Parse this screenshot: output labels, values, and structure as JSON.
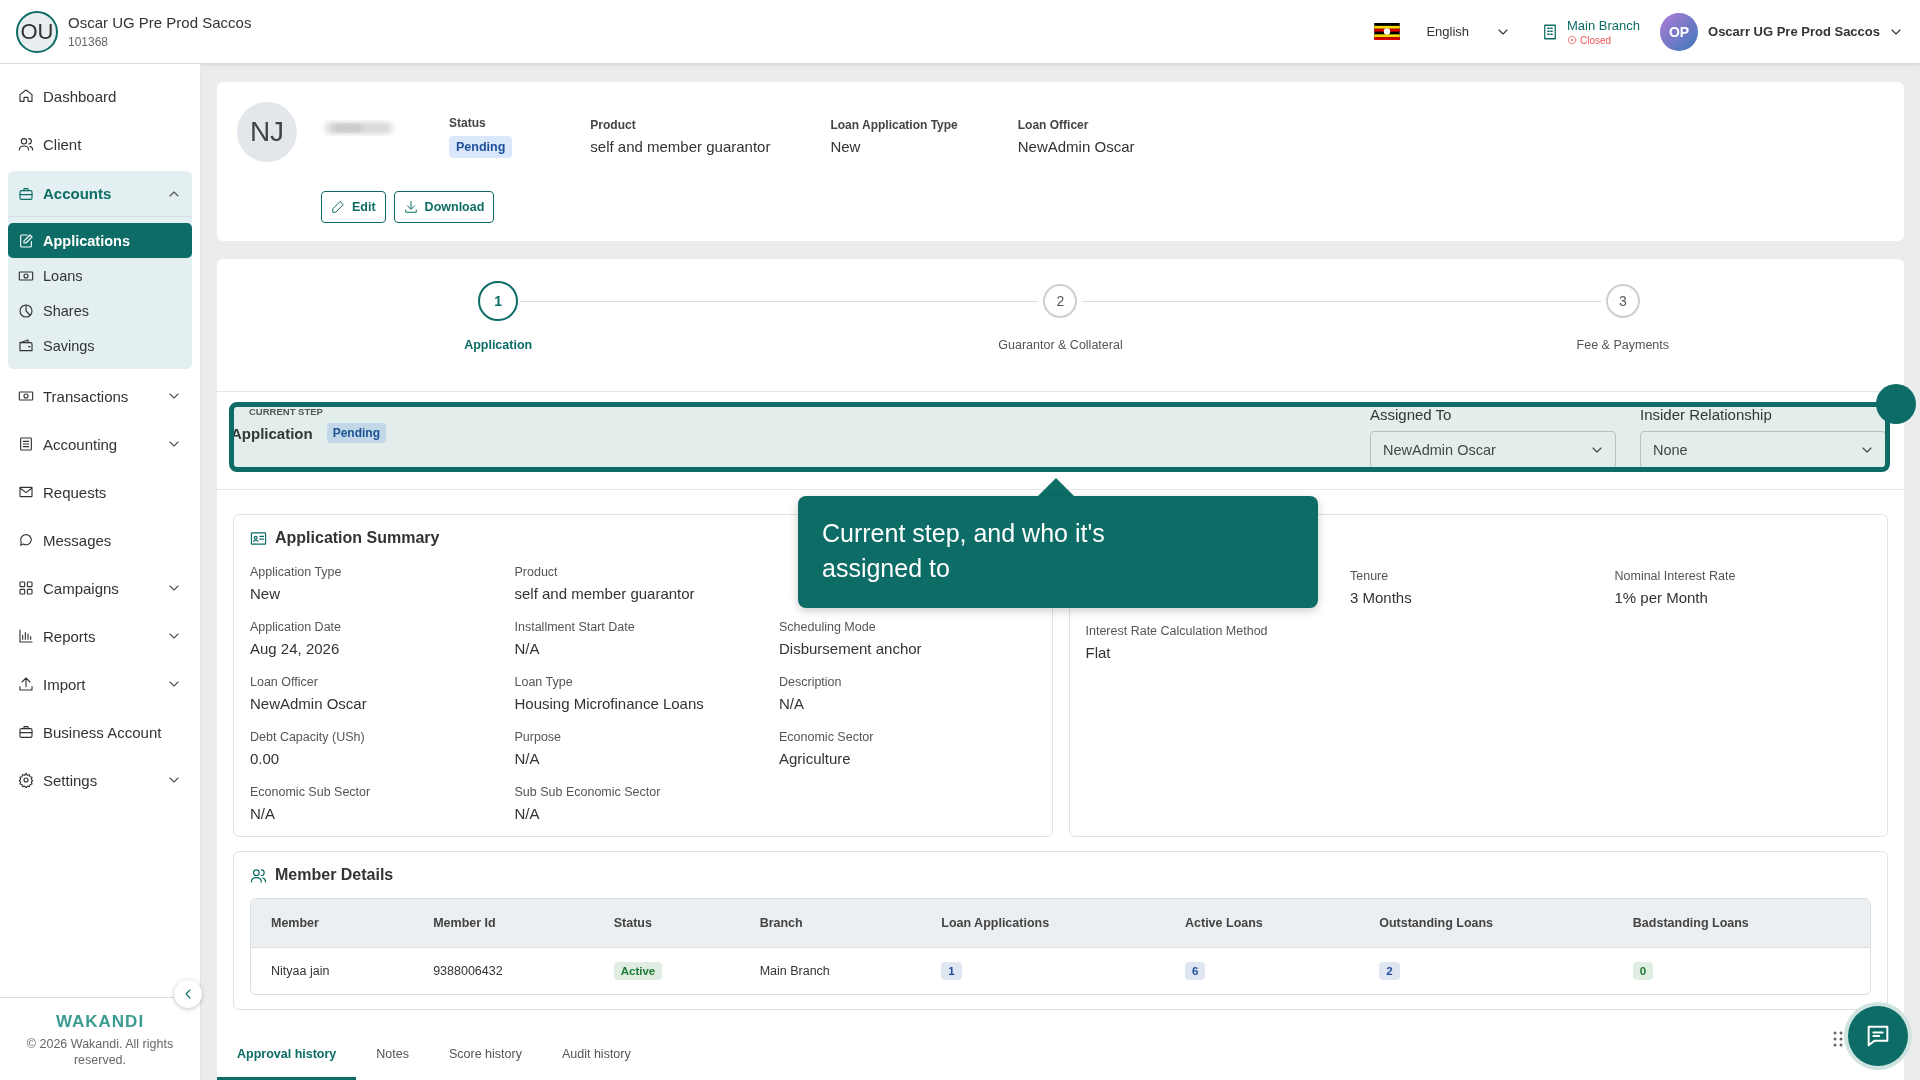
{
  "header": {
    "org_initials": "OU",
    "org_name": "Oscar UG Pre Prod Saccos",
    "org_code": "101368",
    "language": "English",
    "branch": "Main Branch",
    "branch_status": "Closed",
    "user_initials": "OP",
    "user_name": "Oscarr UG Pre Prod Saccos"
  },
  "sidebar": {
    "items": [
      {
        "label": "Dashboard"
      },
      {
        "label": "Client"
      },
      {
        "label": "Accounts",
        "expanded": true,
        "children": [
          {
            "label": "Applications",
            "selected": true
          },
          {
            "label": "Loans",
            "selected": false
          },
          {
            "label": "Shares",
            "selected": false
          },
          {
            "label": "Savings",
            "selected": false
          }
        ]
      },
      {
        "label": "Transactions",
        "expanded": false
      },
      {
        "label": "Accounting",
        "expanded": false
      },
      {
        "label": "Requests"
      },
      {
        "label": "Messages"
      },
      {
        "label": "Campaigns",
        "expanded": false
      },
      {
        "label": "Reports",
        "expanded": false
      },
      {
        "label": "Import",
        "expanded": false
      },
      {
        "label": "Business Account"
      },
      {
        "label": "Settings",
        "expanded": false
      }
    ],
    "brand": "WAKANDI",
    "copyright": "© 2026 Wakandi. All rights reserved."
  },
  "profile": {
    "initials": "NJ",
    "fields": [
      {
        "label": "Status",
        "value": "Pending",
        "kind": "badge"
      },
      {
        "label": "Product",
        "value": "self and member guarantor",
        "kind": "text"
      },
      {
        "label": "Loan Application Type",
        "value": "New",
        "kind": "text"
      },
      {
        "label": "Loan Officer",
        "value": "NewAdmin Oscar",
        "kind": "text"
      }
    ],
    "buttons": [
      "Edit",
      "Download"
    ]
  },
  "stepper": {
    "steps": [
      {
        "number": "1",
        "label": "Application",
        "selected": true
      },
      {
        "number": "2",
        "label": "Guarantor & Collateral",
        "selected": false
      },
      {
        "number": "3",
        "label": "Fee & Payments",
        "selected": false
      }
    ]
  },
  "current_step": {
    "caption": "CURRENT STEP",
    "name": "Application",
    "status": "Pending",
    "assigned_to": {
      "label": "Assigned To",
      "value": "NewAdmin Oscar"
    },
    "insider_relationship": {
      "label": "Insider Relationship",
      "value": "None"
    }
  },
  "tour_tooltip": {
    "text": "Current step, and who it's assigned to"
  },
  "application_summary": {
    "title": "Application Summary",
    "left_rows": [
      [
        {
          "label": "Application Type",
          "value": "New"
        },
        {
          "label": "Product",
          "value": "self and member guarantor"
        }
      ],
      [
        {
          "label": "Application Date",
          "value": "Aug 24, 2026"
        },
        {
          "label": "Installment Start Date",
          "value": "N/A"
        },
        {
          "label": "Scheduling Mode",
          "value": "Disbursement anchor"
        }
      ],
      [
        {
          "label": "Loan Officer",
          "value": "NewAdmin Oscar"
        },
        {
          "label": "Loan Type",
          "value": "Housing Microfinance Loans"
        },
        {
          "label": "Description",
          "value": "N/A"
        }
      ],
      [
        {
          "label": "Debt Capacity (USh)",
          "value": "0.00"
        },
        {
          "label": "Purpose",
          "value": "N/A"
        },
        {
          "label": "Economic Sector",
          "value": "Agriculture"
        }
      ],
      [
        {
          "label": "Economic Sub Sector",
          "value": "N/A"
        },
        {
          "label": "Sub Sub Economic Sector",
          "value": "N/A"
        }
      ]
    ],
    "right_rows": [
      [
        {
          "label": "Tenure",
          "value": "3 Months"
        },
        {
          "label": "Nominal Interest Rate",
          "value": "1% per Month"
        }
      ],
      [
        {
          "label": "Interest Rate Calculation Method",
          "value": "Flat"
        }
      ]
    ]
  },
  "member_details": {
    "title": "Member Details",
    "columns": [
      "Member",
      "Member Id",
      "Status",
      "Branch",
      "Loan Applications",
      "Active Loans",
      "Outstanding Loans",
      "Badstanding Loans"
    ],
    "rows": [
      [
        {
          "kind": "text",
          "value": "Nityaa jain"
        },
        {
          "kind": "text",
          "value": "9388006432"
        },
        {
          "kind": "badge",
          "value": "Active",
          "color": "#1e7b34"
        },
        {
          "kind": "text",
          "value": "Main Branch"
        },
        {
          "kind": "badge",
          "value": "1",
          "color": "#1e4f9c"
        },
        {
          "kind": "badge",
          "value": "6",
          "color": "#1e4f9c"
        },
        {
          "kind": "badge",
          "value": "2",
          "color": "#1e4f9c"
        },
        {
          "kind": "badge",
          "value": "0",
          "color": "#1e7b34"
        }
      ]
    ]
  },
  "tabs": [
    {
      "label": "Approval history",
      "selected": true
    },
    {
      "label": "Notes",
      "selected": false
    },
    {
      "label": "Score history",
      "selected": false
    },
    {
      "label": "Audit history",
      "selected": false
    }
  ]
}
